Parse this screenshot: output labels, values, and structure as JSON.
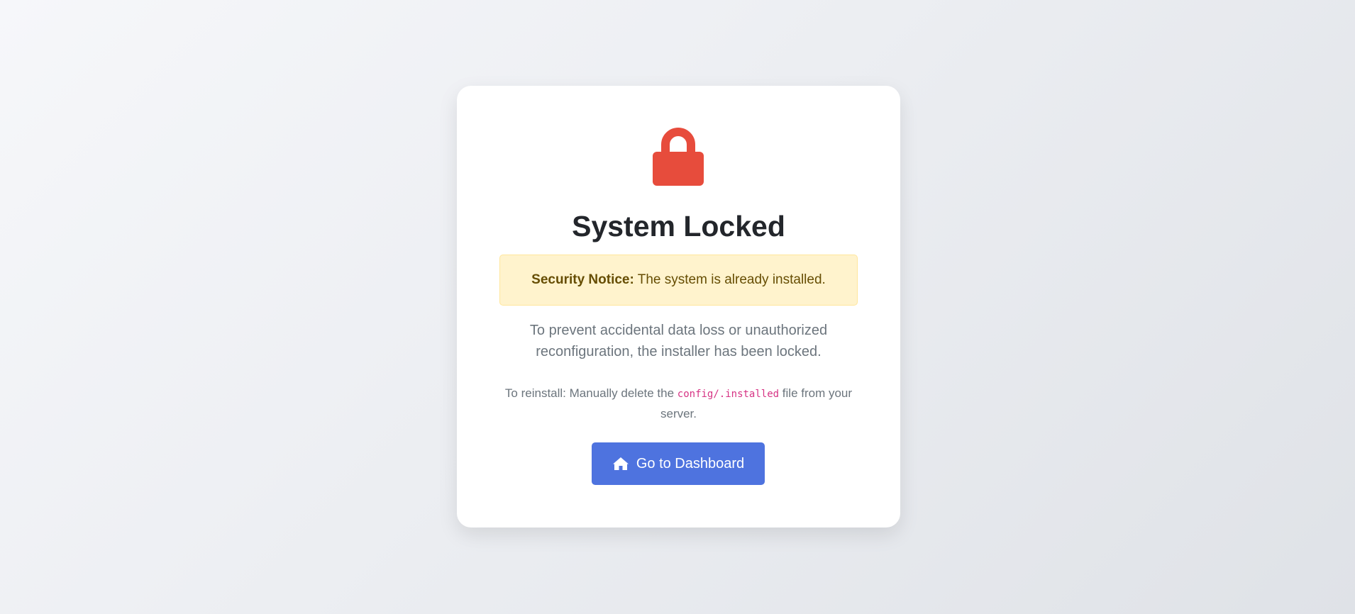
{
  "card": {
    "icon": "lock-icon",
    "title": "System Locked",
    "notice": {
      "label": "Security Notice:",
      "text": " The system is already installed."
    },
    "description": "To prevent accidental data loss or unauthorized reconfiguration, the installer has been locked.",
    "reinstall": {
      "prefix": "To reinstall: Manually delete the ",
      "code": "config/.installed",
      "suffix": " file from your server."
    },
    "button": {
      "icon": "home-icon",
      "label": "Go to Dashboard"
    }
  },
  "colors": {
    "lock": "#e74c3c",
    "button": "#4e73df",
    "notice_background": "#fff3cd",
    "notice_text": "#664d03",
    "code": "#d63384"
  }
}
